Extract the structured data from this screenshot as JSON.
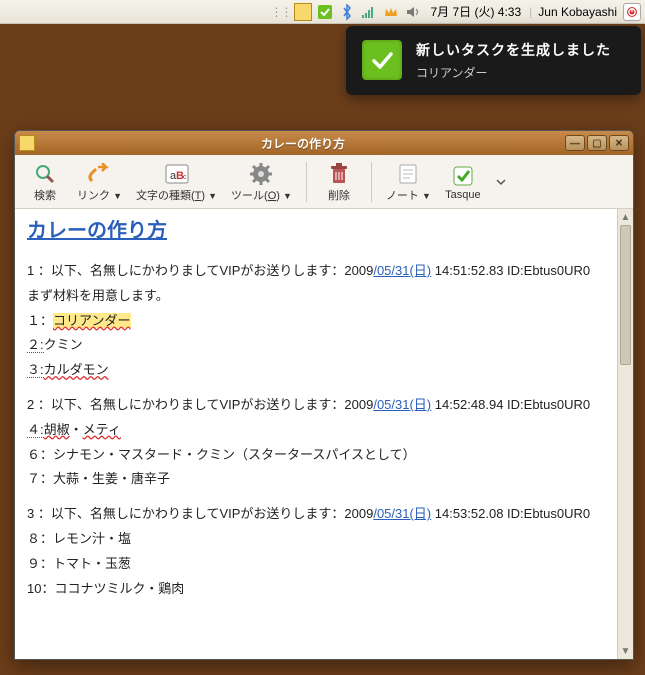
{
  "topbar": {
    "date": "7月 7日 (火) 4:33",
    "user": "Jun Kobayashi"
  },
  "notification": {
    "title": "新しいタスクを生成しました",
    "body": "コリアンダー"
  },
  "window": {
    "title": "カレーの作り方",
    "toolbar": {
      "search": "検索",
      "link": "リンク",
      "chars": "文字の種類",
      "chars_k": "T",
      "tools": "ツール",
      "tools_k": "O",
      "delete": "削除",
      "note": "ノート",
      "tasque": "Tasque"
    }
  },
  "note": {
    "heading": "カレーの作り方",
    "p1": {
      "header_left": "1 ：以下、名無しにかわりましてVIPがお送りします：2009",
      "date_link": "/05/31(日)",
      "header_right": " 14:51:52.83 ID:Ebtus0UR0",
      "line_prep": "まず材料を用意します。",
      "l1_pref": "１：",
      "l1_item": "コリアンダー",
      "l2_pref": "２:",
      "l2_item": "クミン",
      "l3_pref": "３:",
      "l3_item": "カルダモン"
    },
    "p2": {
      "header_left": "2 ：以下、名無しにかわりましてVIPがお送りします：2009",
      "date_link": "/05/31(日)",
      "header_right": " 14:52:48.94 ID:Ebtus0UR0",
      "l4_pref": "４:",
      "l4a": "胡椒",
      "l4mid": "・",
      "l4b": "メティ",
      "l6": "６：シナモン・マスタード・クミン（スタータースパイスとして）",
      "l7": "７：大蒜・生姜・唐辛子"
    },
    "p3": {
      "header_left": "3 ：以下、名無しにかわりましてVIPがお送りします：2009",
      "date_link": "/05/31(日)",
      "header_right": " 14:53:52.08 ID:Ebtus0UR0",
      "l8": "８：レモン汁・塩",
      "l9": "９：トマト・玉葱",
      "l10": "10：ココナツミルク・鶏肉"
    }
  }
}
